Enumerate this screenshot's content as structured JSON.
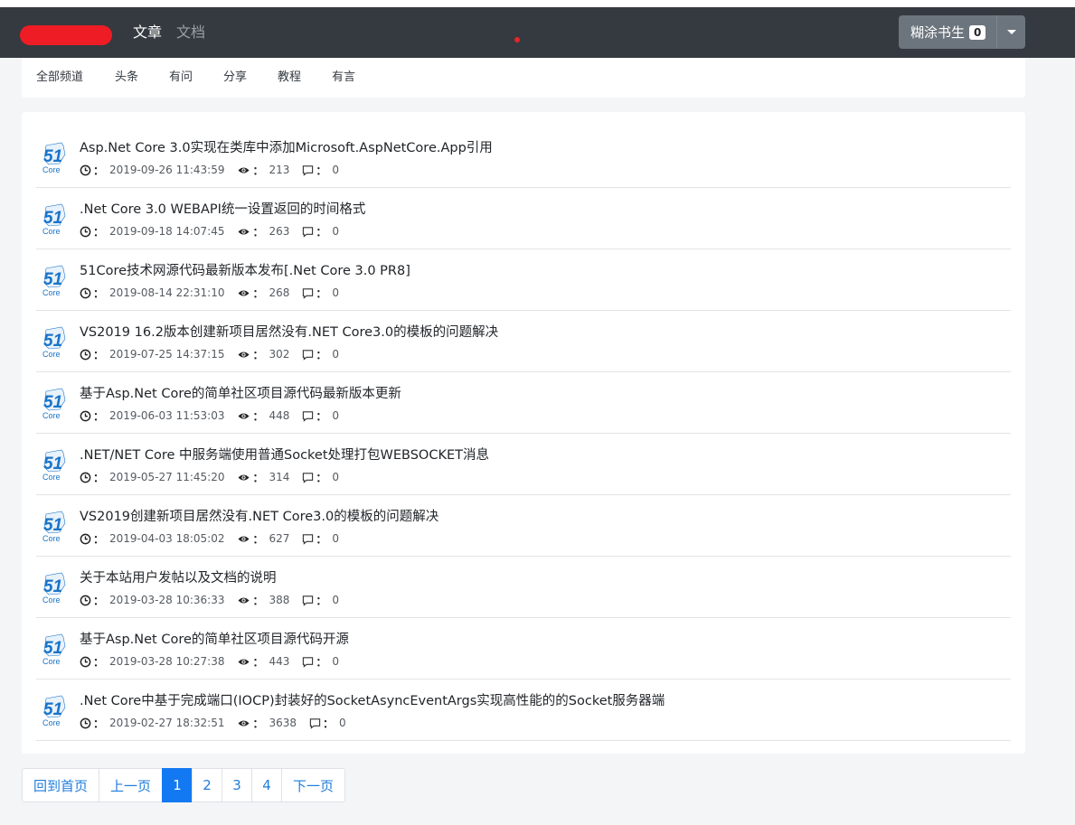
{
  "navbar": {
    "nav_active": "文章",
    "nav_inactive": "文档",
    "user": {
      "name": "糊涂书生",
      "badge": "0"
    }
  },
  "channels": [
    "全部频道",
    "头条",
    "有问",
    "分享",
    "教程",
    "有言"
  ],
  "articles": [
    {
      "title": "Asp.Net Core 3.0实现在类库中添加Microsoft.AspNetCore.App引用",
      "time": "2019-09-26 11:43:59",
      "views": "213",
      "comments": "0"
    },
    {
      "title": ".Net Core 3.0 WEBAPI统一设置返回的时间格式",
      "time": "2019-09-18 14:07:45",
      "views": "263",
      "comments": "0"
    },
    {
      "title": "51Core技术网源代码最新版本发布[.Net Core 3.0 PR8]",
      "time": "2019-08-14 22:31:10",
      "views": "268",
      "comments": "0"
    },
    {
      "title": "VS2019 16.2版本创建新项目居然没有.NET Core3.0的模板的问题解决",
      "time": "2019-07-25 14:37:15",
      "views": "302",
      "comments": "0"
    },
    {
      "title": "基于Asp.Net Core的简单社区项目源代码最新版本更新",
      "time": "2019-06-03 11:53:03",
      "views": "448",
      "comments": "0"
    },
    {
      "title": ".NET/NET Core 中服务端使用普通Socket处理打包WEBSOCKET消息",
      "time": "2019-05-27 11:45:20",
      "views": "314",
      "comments": "0"
    },
    {
      "title": "VS2019创建新项目居然没有.NET Core3.0的模板的问题解决",
      "time": "2019-04-03 18:05:02",
      "views": "627",
      "comments": "0"
    },
    {
      "title": "关于本站用户发帖以及文档的说明",
      "time": "2019-03-28 10:36:33",
      "views": "388",
      "comments": "0"
    },
    {
      "title": "基于Asp.Net Core的简单社区项目源代码开源",
      "time": "2019-03-28 10:27:38",
      "views": "443",
      "comments": "0"
    },
    {
      "title": ".Net Core中基于完成端口(IOCP)封装好的SocketAsyncEventArgs实现高性能的的Socket服务器端",
      "time": "2019-02-27 18:32:51",
      "views": "3638",
      "comments": "0"
    }
  ],
  "article_logo": {
    "number": "51",
    "word": "Core"
  },
  "meta_colon": "：",
  "pagination": {
    "home": "回到首页",
    "prev": "上一页",
    "pages": [
      "1",
      "2",
      "3",
      "4"
    ],
    "current": "1",
    "next": "下一页"
  },
  "colors": {
    "navbar_bg": "#343a40",
    "logo_blue": "#1a74c8",
    "active_page": "#1379f2",
    "link": "#1f7ddc"
  },
  "icons": {
    "time": "clock-icon",
    "views": "eye-icon",
    "comments": "comment-icon"
  }
}
